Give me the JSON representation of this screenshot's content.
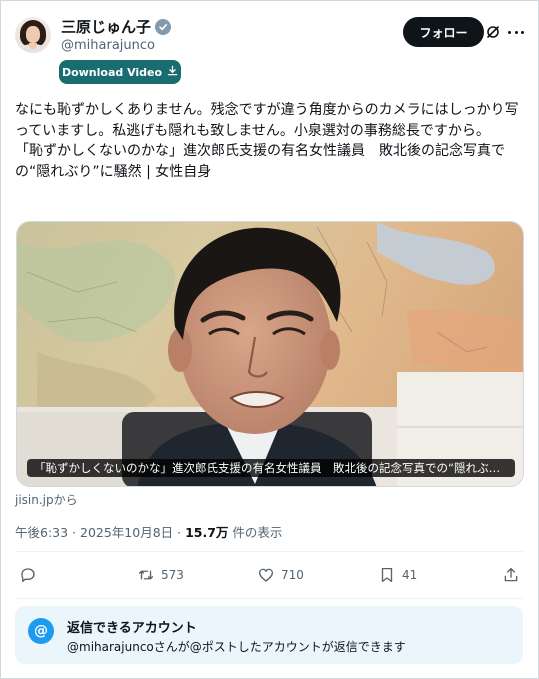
{
  "header": {
    "display_name": "三原じゅん子",
    "handle": "@miharajunco",
    "download_label": "Download Video",
    "follow_label": "フォロー"
  },
  "tweet": {
    "lines": [
      "なにも恥ずかしくありません。残念ですが違う角度からのカメラにはしっかり写っていますし。私逃げも隠れも致しません。小泉選対の事務総長ですから。",
      "「恥ずかしくないのかな」進次郎氏支援の有名女性議員　敗北後の記念写真での“隠れぶり”に騒然 | 女性自身"
    ]
  },
  "media": {
    "caption": "「恥ずかしくないのかな」進次郎氏支援の有名女性議員　敗北後の記念写真での“隠れぶ…"
  },
  "source": "jisin.jpから",
  "meta": {
    "time_date": "午後6:33 · 2025年10月8日 · ",
    "views_count": "15.7万",
    "views_suffix": " 件の表示"
  },
  "actions": {
    "retweets": "573",
    "likes": "710",
    "bookmarks": "41"
  },
  "reply_notice": {
    "title": "返信できるアカウント",
    "description": "@miharajuncoさんが@ポストしたアカウントが返信できます"
  },
  "colors": {
    "accent": "#1d9bf0",
    "download_button": "#196d71",
    "follow_button": "#0f1419",
    "secondary_text": "#536471"
  },
  "icons": [
    "verified-icon",
    "download-icon",
    "grok-icon",
    "more-icon",
    "reply-icon",
    "retweet-icon",
    "like-icon",
    "bookmark-icon",
    "share-icon",
    "at-icon"
  ]
}
